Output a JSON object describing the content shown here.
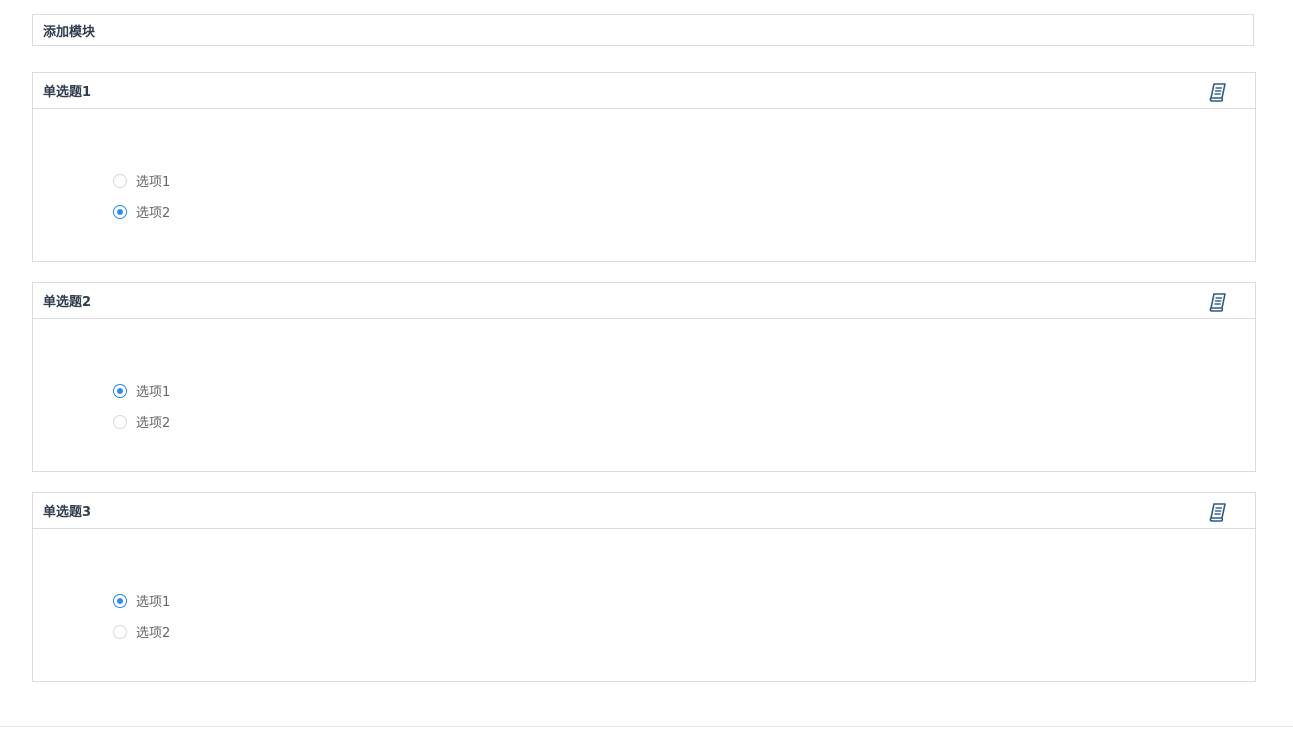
{
  "add_module": {
    "label": "添加模块"
  },
  "questions": [
    {
      "title": "单选题1",
      "icon": "edit-document-icon",
      "options": [
        {
          "label": "选项1",
          "checked": false
        },
        {
          "label": "选项2",
          "checked": true
        }
      ]
    },
    {
      "title": "单选题2",
      "icon": "edit-document-icon",
      "options": [
        {
          "label": "选项1",
          "checked": true
        },
        {
          "label": "选项2",
          "checked": false
        }
      ]
    },
    {
      "title": "单选题3",
      "icon": "edit-document-icon",
      "options": [
        {
          "label": "选项1",
          "checked": true
        },
        {
          "label": "选项2",
          "checked": false
        }
      ]
    }
  ],
  "colors": {
    "accent": "#2d8cf0",
    "border": "#dcdcdc",
    "title_text": "#2f3d4f",
    "icon": "#2b5a8a"
  }
}
